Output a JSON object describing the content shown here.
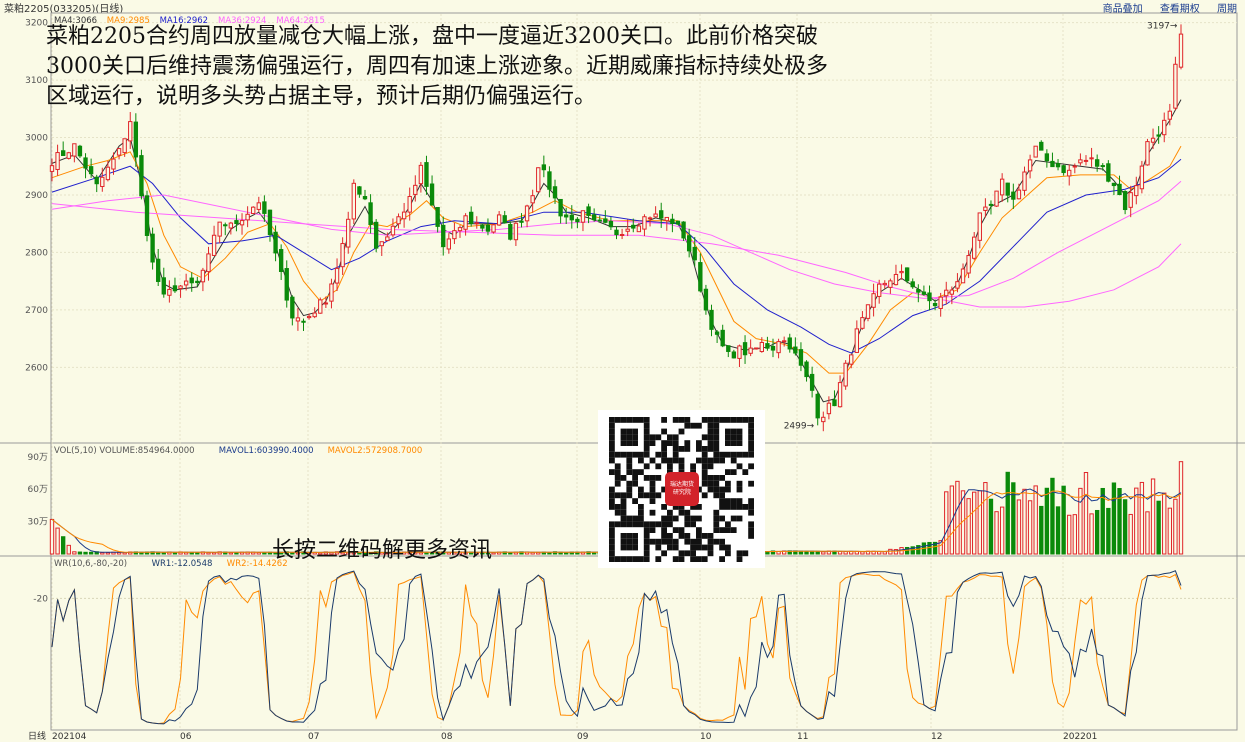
{
  "header": {
    "title": "菜粕2205(033205)(日线)",
    "links": [
      "商品叠加",
      "查看期权",
      "周期"
    ]
  },
  "headline": "菜粕2205合约周四放量减仓大幅上涨，盘中一度逼近3200关口。此前价格突破3000关口后维持震荡偏强运行，周四有加速上涨迹象。近期威廉指标持续处极多区域运行，说明多头势占据主导，预计后期仍偏强运行。",
  "qr_caption": "长按二维码解更多资讯",
  "qr_logo_text": [
    "瑞达期货",
    "研究院"
  ],
  "axis_label_period": "日线",
  "colors": {
    "up": "#e0262a",
    "down": "#0b8a0b",
    "ma4": "#333333",
    "ma9": "#ff8a00",
    "ma16": "#2020cc",
    "ma36": "#ff66ff",
    "ma64": "#ff66ff",
    "wr1": "#1a3a6a",
    "wr2": "#ff8a00"
  },
  "chart_data": [
    {
      "type": "candlestick",
      "legend": [
        {
          "label": "MA4:3066",
          "color": "#333333"
        },
        {
          "label": "MA9:2985",
          "color": "#ff8a00"
        },
        {
          "label": "MA16:2962",
          "color": "#2020cc"
        },
        {
          "label": "MA36:2924",
          "color": "#ff66ff"
        },
        {
          "label": "MA64:2815",
          "color": "#ff66ff"
        }
      ],
      "y_ticks": [
        2600,
        2700,
        2800,
        2900,
        3000,
        3100,
        3200
      ],
      "ylim": [
        2470,
        3215
      ],
      "x_tick_labels": [
        "202104",
        "06",
        "07",
        "08",
        "09",
        "10",
        "11",
        "12",
        "202201"
      ],
      "annotations": [
        {
          "label": "3197",
          "price": 3197
        },
        {
          "label": "2499",
          "price": 2499
        }
      ],
      "close_path": [
        [
          0,
          2960
        ],
        [
          4,
          2985
        ],
        [
          8,
          2915
        ],
        [
          12,
          2975
        ],
        [
          14,
          3030
        ],
        [
          16,
          2895
        ],
        [
          18,
          2780
        ],
        [
          20,
          2720
        ],
        [
          22,
          2740
        ],
        [
          26,
          2745
        ],
        [
          28,
          2790
        ],
        [
          30,
          2855
        ],
        [
          32,
          2845
        ],
        [
          35,
          2870
        ],
        [
          37,
          2890
        ],
        [
          39,
          2830
        ],
        [
          41,
          2760
        ],
        [
          43,
          2690
        ],
        [
          45,
          2680
        ],
        [
          47,
          2700
        ],
        [
          49,
          2720
        ],
        [
          51,
          2775
        ],
        [
          53,
          2850
        ],
        [
          54,
          2920
        ],
        [
          56,
          2895
        ],
        [
          58,
          2810
        ],
        [
          60,
          2830
        ],
        [
          62,
          2860
        ],
        [
          64,
          2890
        ],
        [
          66,
          2945
        ],
        [
          68,
          2880
        ],
        [
          70,
          2810
        ],
        [
          72,
          2830
        ],
        [
          74,
          2860
        ],
        [
          76,
          2850
        ],
        [
          78,
          2840
        ],
        [
          80,
          2860
        ],
        [
          82,
          2830
        ],
        [
          84,
          2860
        ],
        [
          86,
          2905
        ],
        [
          87,
          2955
        ],
        [
          89,
          2915
        ],
        [
          91,
          2870
        ],
        [
          93,
          2855
        ],
        [
          95,
          2865
        ],
        [
          97,
          2850
        ],
        [
          99,
          2845
        ],
        [
          101,
          2835
        ],
        [
          103,
          2845
        ],
        [
          105,
          2855
        ],
        [
          107,
          2865
        ],
        [
          109,
          2860
        ],
        [
          111,
          2855
        ],
        [
          113,
          2830
        ],
        [
          115,
          2780
        ],
        [
          117,
          2700
        ],
        [
          119,
          2650
        ],
        [
          121,
          2620
        ],
        [
          123,
          2630
        ],
        [
          125,
          2625
        ],
        [
          127,
          2640
        ],
        [
          129,
          2635
        ],
        [
          130,
          2650
        ],
        [
          132,
          2640
        ],
        [
          134,
          2600
        ],
        [
          136,
          2560
        ],
        [
          138,
          2520
        ],
        [
          140,
          2540
        ],
        [
          142,
          2600
        ],
        [
          144,
          2660
        ],
        [
          146,
          2700
        ],
        [
          148,
          2740
        ],
        [
          150,
          2755
        ],
        [
          152,
          2760
        ],
        [
          154,
          2745
        ],
        [
          156,
          2720
        ],
        [
          158,
          2710
        ],
        [
          160,
          2730
        ],
        [
          162,
          2745
        ],
        [
          164,
          2800
        ],
        [
          166,
          2860
        ],
        [
          168,
          2880
        ],
        [
          170,
          2920
        ],
        [
          172,
          2890
        ],
        [
          174,
          2940
        ],
        [
          176,
          2980
        ],
        [
          178,
          2960
        ],
        [
          180,
          2950
        ],
        [
          182,
          2940
        ],
        [
          184,
          2960
        ],
        [
          186,
          2960
        ],
        [
          188,
          2945
        ],
        [
          190,
          2920
        ],
        [
          192,
          2880
        ],
        [
          194,
          2920
        ],
        [
          196,
          2990
        ],
        [
          198,
          3010
        ],
        [
          200,
          3040
        ],
        [
          201,
          3120
        ],
        [
          202,
          3180
        ]
      ],
      "ma4_path": [
        [
          0,
          2955
        ],
        [
          4,
          2970
        ],
        [
          8,
          2925
        ],
        [
          12,
          2985
        ],
        [
          14,
          3000
        ],
        [
          16,
          2920
        ],
        [
          18,
          2810
        ],
        [
          20,
          2745
        ],
        [
          22,
          2735
        ],
        [
          26,
          2740
        ],
        [
          28,
          2775
        ],
        [
          32,
          2840
        ],
        [
          35,
          2860
        ],
        [
          37,
          2870
        ],
        [
          39,
          2845
        ],
        [
          41,
          2780
        ],
        [
          43,
          2720
        ],
        [
          45,
          2690
        ],
        [
          47,
          2695
        ],
        [
          49,
          2715
        ],
        [
          51,
          2760
        ],
        [
          53,
          2830
        ],
        [
          56,
          2880
        ],
        [
          58,
          2840
        ],
        [
          60,
          2830
        ],
        [
          62,
          2850
        ],
        [
          64,
          2880
        ],
        [
          66,
          2920
        ],
        [
          68,
          2890
        ],
        [
          70,
          2840
        ],
        [
          72,
          2830
        ],
        [
          74,
          2850
        ],
        [
          76,
          2850
        ],
        [
          80,
          2850
        ],
        [
          84,
          2855
        ],
        [
          86,
          2885
        ],
        [
          88,
          2920
        ],
        [
          90,
          2900
        ],
        [
          92,
          2870
        ],
        [
          96,
          2860
        ],
        [
          100,
          2845
        ],
        [
          104,
          2845
        ],
        [
          108,
          2860
        ],
        [
          112,
          2850
        ],
        [
          114,
          2810
        ],
        [
          116,
          2740
        ],
        [
          118,
          2680
        ],
        [
          120,
          2640
        ],
        [
          124,
          2630
        ],
        [
          128,
          2635
        ],
        [
          130,
          2645
        ],
        [
          132,
          2640
        ],
        [
          134,
          2610
        ],
        [
          136,
          2575
        ],
        [
          138,
          2540
        ],
        [
          140,
          2545
        ],
        [
          142,
          2590
        ],
        [
          144,
          2650
        ],
        [
          146,
          2695
        ],
        [
          148,
          2730
        ],
        [
          152,
          2755
        ],
        [
          156,
          2730
        ],
        [
          158,
          2715
        ],
        [
          160,
          2725
        ],
        [
          162,
          2745
        ],
        [
          164,
          2790
        ],
        [
          166,
          2845
        ],
        [
          168,
          2880
        ],
        [
          172,
          2900
        ],
        [
          176,
          2960
        ],
        [
          180,
          2955
        ],
        [
          184,
          2950
        ],
        [
          188,
          2945
        ],
        [
          190,
          2925
        ],
        [
          192,
          2900
        ],
        [
          194,
          2915
        ],
        [
          196,
          2970
        ],
        [
          198,
          3000
        ],
        [
          200,
          3030
        ],
        [
          202,
          3066
        ]
      ],
      "ma9_path": [
        [
          0,
          2930
        ],
        [
          6,
          2950
        ],
        [
          10,
          2960
        ],
        [
          14,
          2975
        ],
        [
          17,
          2920
        ],
        [
          20,
          2830
        ],
        [
          23,
          2775
        ],
        [
          27,
          2755
        ],
        [
          31,
          2790
        ],
        [
          35,
          2835
        ],
        [
          39,
          2850
        ],
        [
          42,
          2810
        ],
        [
          45,
          2750
        ],
        [
          48,
          2715
        ],
        [
          51,
          2735
        ],
        [
          54,
          2800
        ],
        [
          57,
          2850
        ],
        [
          60,
          2845
        ],
        [
          64,
          2865
        ],
        [
          67,
          2890
        ],
        [
          70,
          2860
        ],
        [
          74,
          2845
        ],
        [
          80,
          2850
        ],
        [
          86,
          2870
        ],
        [
          90,
          2890
        ],
        [
          94,
          2870
        ],
        [
          100,
          2855
        ],
        [
          106,
          2855
        ],
        [
          112,
          2855
        ],
        [
          116,
          2800
        ],
        [
          119,
          2740
        ],
        [
          122,
          2680
        ],
        [
          126,
          2650
        ],
        [
          131,
          2640
        ],
        [
          135,
          2625
        ],
        [
          139,
          2590
        ],
        [
          142,
          2590
        ],
        [
          146,
          2640
        ],
        [
          150,
          2700
        ],
        [
          154,
          2730
        ],
        [
          158,
          2720
        ],
        [
          162,
          2735
        ],
        [
          166,
          2800
        ],
        [
          170,
          2860
        ],
        [
          174,
          2895
        ],
        [
          178,
          2930
        ],
        [
          184,
          2935
        ],
        [
          190,
          2935
        ],
        [
          193,
          2910
        ],
        [
          196,
          2925
        ],
        [
          200,
          2950
        ],
        [
          202,
          2985
        ]
      ],
      "ma16_path": [
        [
          0,
          2905
        ],
        [
          8,
          2930
        ],
        [
          14,
          2950
        ],
        [
          18,
          2920
        ],
        [
          23,
          2860
        ],
        [
          28,
          2815
        ],
        [
          34,
          2820
        ],
        [
          40,
          2830
        ],
        [
          45,
          2800
        ],
        [
          50,
          2770
        ],
        [
          55,
          2790
        ],
        [
          60,
          2820
        ],
        [
          66,
          2845
        ],
        [
          72,
          2855
        ],
        [
          80,
          2850
        ],
        [
          88,
          2870
        ],
        [
          95,
          2870
        ],
        [
          105,
          2855
        ],
        [
          112,
          2850
        ],
        [
          117,
          2805
        ],
        [
          122,
          2745
        ],
        [
          128,
          2700
        ],
        [
          134,
          2670
        ],
        [
          139,
          2640
        ],
        [
          143,
          2625
        ],
        [
          148,
          2650
        ],
        [
          154,
          2690
        ],
        [
          160,
          2710
        ],
        [
          166,
          2750
        ],
        [
          172,
          2810
        ],
        [
          178,
          2870
        ],
        [
          185,
          2900
        ],
        [
          192,
          2910
        ],
        [
          198,
          2930
        ],
        [
          202,
          2962
        ]
      ],
      "ma36_path": [
        [
          0,
          2875
        ],
        [
          10,
          2890
        ],
        [
          20,
          2900
        ],
        [
          30,
          2880
        ],
        [
          40,
          2860
        ],
        [
          50,
          2840
        ],
        [
          60,
          2830
        ],
        [
          70,
          2835
        ],
        [
          80,
          2840
        ],
        [
          90,
          2850
        ],
        [
          100,
          2855
        ],
        [
          110,
          2850
        ],
        [
          118,
          2830
        ],
        [
          125,
          2800
        ],
        [
          132,
          2770
        ],
        [
          140,
          2745
        ],
        [
          148,
          2730
        ],
        [
          156,
          2720
        ],
        [
          164,
          2725
        ],
        [
          172,
          2755
        ],
        [
          180,
          2800
        ],
        [
          190,
          2850
        ],
        [
          198,
          2890
        ],
        [
          202,
          2924
        ]
      ],
      "ma64_path": [
        [
          0,
          2885
        ],
        [
          15,
          2870
        ],
        [
          30,
          2860
        ],
        [
          45,
          2850
        ],
        [
          60,
          2840
        ],
        [
          75,
          2835
        ],
        [
          90,
          2830
        ],
        [
          105,
          2830
        ],
        [
          118,
          2815
        ],
        [
          130,
          2795
        ],
        [
          142,
          2765
        ],
        [
          150,
          2740
        ],
        [
          158,
          2720
        ],
        [
          166,
          2705
        ],
        [
          174,
          2705
        ],
        [
          182,
          2715
        ],
        [
          190,
          2735
        ],
        [
          198,
          2775
        ],
        [
          202,
          2815
        ]
      ]
    },
    {
      "type": "bar",
      "legend": [
        {
          "label": "VOL(5,10) VOLUME:854964.0000",
          "color": "#555555"
        },
        {
          "label": "MAVOL1:603990.4000",
          "color": "#1a3a8a"
        },
        {
          "label": "MAVOL2:572908.7000",
          "color": "#ff8a00"
        }
      ],
      "y_ticks": [
        {
          "label": "30万",
          "value": 300000
        },
        {
          "label": "60万",
          "value": 600000
        },
        {
          "label": "90万",
          "value": 900000
        }
      ],
      "ylim": [
        0,
        1000000
      ],
      "last_volume": 854964,
      "mavol1": 603990.4,
      "mavol2": 572908.7
    },
    {
      "type": "line",
      "legend": [
        {
          "label": "WR(10,6,-80,-20)",
          "color": "#555555"
        },
        {
          "label": "WR1:-12.0548",
          "color": "#1a3a6a"
        },
        {
          "label": "WR2:-14.4262",
          "color": "#ff8a00"
        }
      ],
      "y_ticks": [
        {
          "label": "-20",
          "value": -20
        }
      ],
      "ylim": [
        -100,
        0
      ],
      "last_wr1": -12.0548,
      "last_wr2": -14.4262
    }
  ]
}
